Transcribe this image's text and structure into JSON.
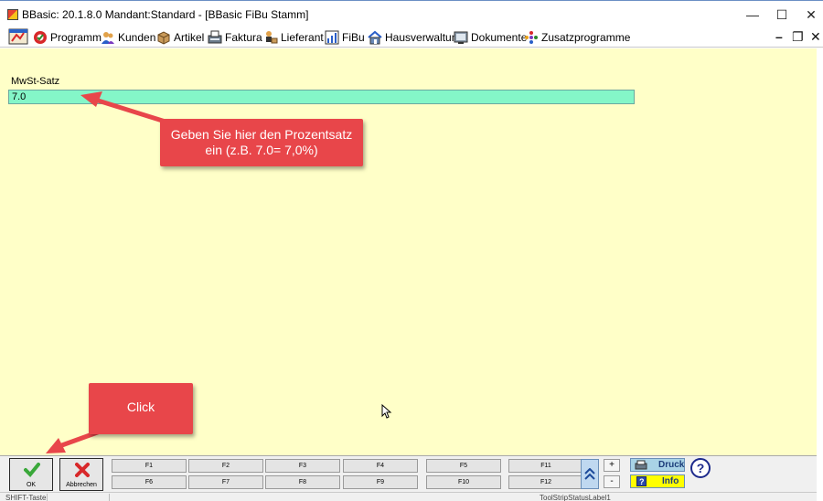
{
  "window": {
    "title": "BBasic: 20.1.8.0 Mandant:Standard  - [BBasic FiBu Stamm]",
    "minimize": "—",
    "maximize": "☐",
    "close": "✕"
  },
  "toolbar": {
    "items": [
      {
        "label": "Programm",
        "icon": "program-icon"
      },
      {
        "label": "Kunden",
        "icon": "customers-icon"
      },
      {
        "label": "Artikel",
        "icon": "articles-icon"
      },
      {
        "label": "Faktura",
        "icon": "invoice-icon"
      },
      {
        "label": "Lieferant",
        "icon": "supplier-icon"
      },
      {
        "label": "FiBu",
        "icon": "accounting-icon"
      },
      {
        "label": "Hausverwaltung",
        "icon": "property-icon"
      },
      {
        "label": "Dokumente",
        "icon": "documents-icon"
      },
      {
        "label": "Zusatzprogramme",
        "icon": "addons-icon"
      }
    ],
    "mdi_minimize": "–",
    "mdi_restore": "❐",
    "mdi_close": "✕"
  },
  "form": {
    "label": "MwSt-Satz",
    "value": "7.0"
  },
  "callouts": {
    "hint_line1": "Geben Sie hier den Prozentsatz",
    "hint_line2": "ein (z.B. 7.0= 7,0%)",
    "click": "Click"
  },
  "bottom": {
    "ok_label": "OK",
    "cancel_label": "Abbrechen",
    "fkeys_row1": [
      "F1",
      "F2",
      "F3",
      "F4",
      "F5",
      "F11"
    ],
    "fkeys_row2": [
      "F6",
      "F7",
      "F8",
      "F9",
      "F10",
      "F12"
    ],
    "plus": "+",
    "minus": "-",
    "druck": "Druck",
    "info": "Info",
    "help": "?"
  },
  "status": {
    "cell1": "SHIFT-Taste",
    "cell2": "ToolStripStatusLabel1"
  },
  "colors": {
    "panel_bg": "#ffffc8",
    "input_bg": "#84f6c8",
    "callout_bg": "#e8464a"
  }
}
